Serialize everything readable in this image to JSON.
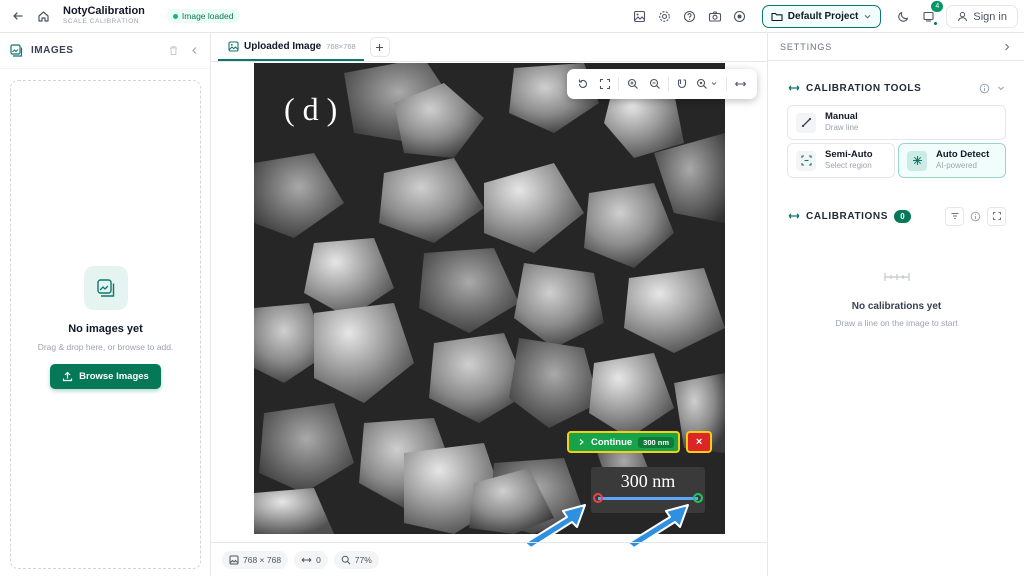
{
  "app": {
    "title": "NotyCalibration",
    "subtitle": "SCALE CALIBRATION",
    "status_badge": "Image loaded",
    "project": "Default Project",
    "notification_count": "4",
    "signin": "Sign in"
  },
  "icons": {
    "back": "arrow-left-icon",
    "home": "home-icon",
    "image": "image-icon",
    "settings": "gear-icon",
    "help": "help-circle-icon",
    "camera": "camera-icon",
    "record": "record-icon",
    "folder": "folder-icon",
    "theme": "moon-icon",
    "notifications": "notification-icon",
    "user": "user-icon"
  },
  "left_panel": {
    "title": "IMAGES",
    "empty_title": "No images yet",
    "empty_sub": "Drag & drop here, or browse to add.",
    "browse_label": "Browse Images"
  },
  "center": {
    "tab_label": "Uploaded Image",
    "tab_size": "768×768",
    "image_label": "( d )",
    "continue_label": "Continue",
    "continue_badge": "300 nm",
    "cancel_label": "×",
    "scalebar_text": "300 nm",
    "status": {
      "dimensions": "768 × 768",
      "calibrations": "0",
      "zoom": "77%"
    }
  },
  "right_panel": {
    "title": "SETTINGS",
    "calibration_tools_title": "CALIBRATION TOOLS",
    "tools": [
      {
        "name": "Manual",
        "sub": "Draw line"
      },
      {
        "name": "Semi-Auto",
        "sub": "Select region"
      },
      {
        "name": "Auto Detect",
        "sub": "AI-powered"
      }
    ],
    "calibrations_title": "CALIBRATIONS",
    "calibrations_count": "0",
    "empty_title": "No calibrations yet",
    "empty_sub": "Draw a line on the image to start"
  },
  "colors": {
    "accent": "#047857",
    "continue": "#16a34a",
    "cancel": "#dc2626",
    "highlight": "#facc15",
    "pointer_arrow": "#2f8fe0"
  }
}
